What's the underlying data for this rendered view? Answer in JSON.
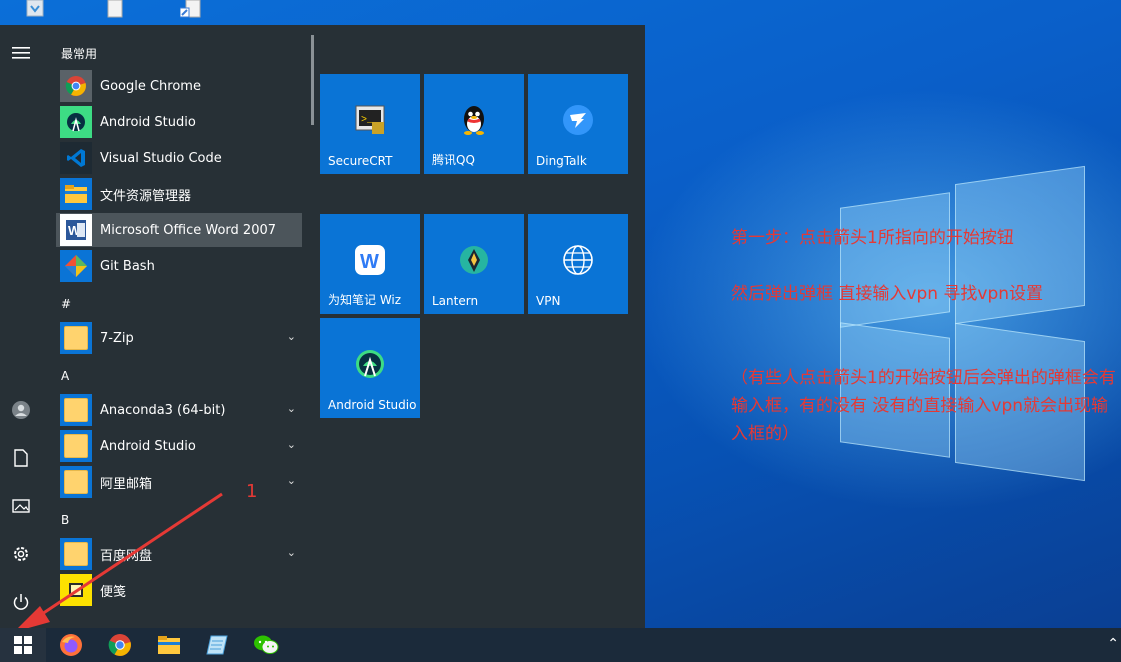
{
  "start_menu": {
    "section_frequent": "最常用",
    "frequent_apps": [
      {
        "label": "Google Chrome",
        "icon": "chrome-icon"
      },
      {
        "label": "Android Studio",
        "icon": "android-studio-icon"
      },
      {
        "label": "Visual Studio Code",
        "icon": "vscode-icon"
      },
      {
        "label": "文件资源管理器",
        "icon": "file-explorer-icon"
      },
      {
        "label": "Microsoft Office Word 2007",
        "icon": "word-icon"
      },
      {
        "label": "Git Bash",
        "icon": "git-bash-icon"
      }
    ],
    "section_hash": "#",
    "hash_apps": [
      {
        "label": "7-Zip",
        "icon": "folder-icon"
      }
    ],
    "section_a": "A",
    "a_apps": [
      {
        "label": "Anaconda3 (64-bit)",
        "icon": "folder-icon"
      },
      {
        "label": "Android Studio",
        "icon": "folder-icon"
      },
      {
        "label": "阿里邮箱",
        "icon": "folder-icon"
      }
    ],
    "section_b": "B",
    "b_apps": [
      {
        "label": "百度网盘",
        "icon": "folder-icon"
      },
      {
        "label": "便笺",
        "icon": "sticky-notes-icon"
      }
    ]
  },
  "tiles": [
    {
      "label": "SecureCRT",
      "icon": "securecrt-icon"
    },
    {
      "label": "腾讯QQ",
      "icon": "qq-icon"
    },
    {
      "label": "DingTalk",
      "icon": "dingtalk-icon"
    },
    {
      "label": "为知笔记 Wiz",
      "icon": "wiz-icon"
    },
    {
      "label": "Lantern",
      "icon": "lantern-icon"
    },
    {
      "label": "VPN",
      "icon": "globe-icon"
    },
    {
      "label": "Android Studio",
      "icon": "android-studio-icon"
    }
  ],
  "annotation": {
    "arrow_number": "1",
    "line1": "第一步：点击箭头1所指向的开始按钮",
    "line2": "然后弹出弹框     直接输入vpn  寻找vpn设置",
    "line3": "（有些人点击箭头1的开始按钮后会弹出的弹框会有输入框，有的没有 没有的直接输入vpn就会出现输入框的）"
  },
  "colors": {
    "accent_tile": "#0a74d6",
    "menu_bg": "#273036",
    "annotation_red": "#e53935"
  }
}
